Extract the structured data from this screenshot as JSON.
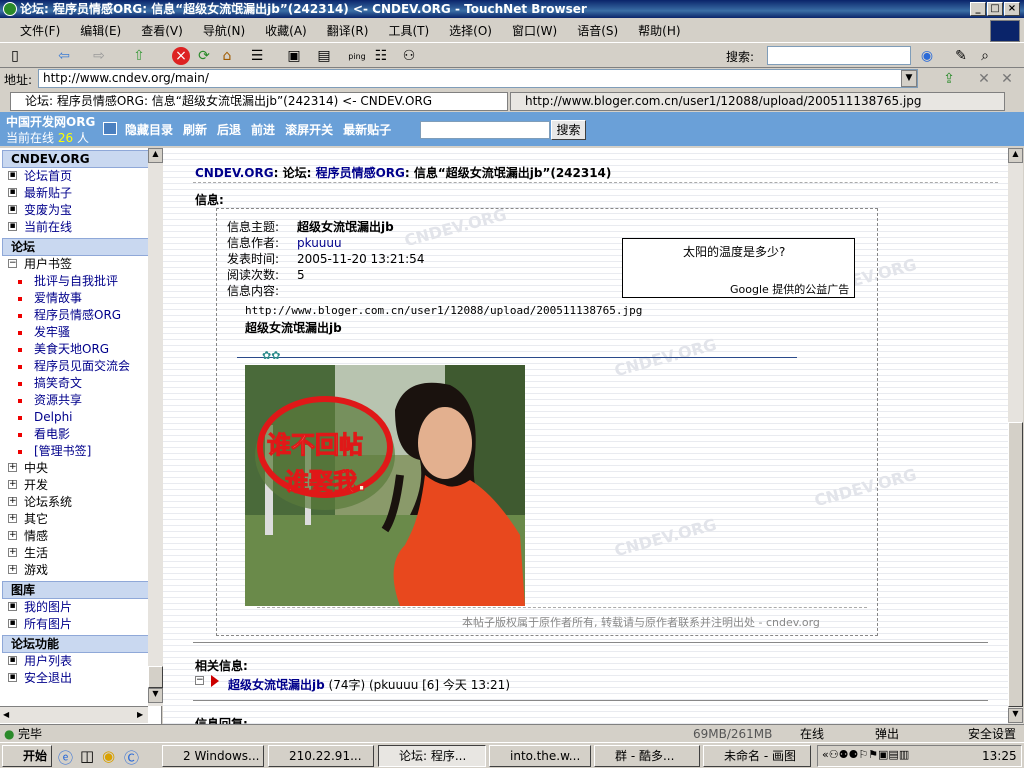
{
  "window": {
    "title": "论坛: 程序员情感ORG: 信息“超级女流氓漏出jb”(242314) <- CNDEV.ORG - TouchNet Browser"
  },
  "menu": [
    "文件(F)",
    "编辑(E)",
    "查看(V)",
    "导航(N)",
    "收藏(A)",
    "翻译(R)",
    "工具(T)",
    "选择(O)",
    "窗口(W)",
    "语音(S)",
    "帮助(H)"
  ],
  "toolbar": {
    "search_label": "搜索:"
  },
  "address": {
    "label": "地址:",
    "url": "http://www.cndev.org/main/"
  },
  "tabs": [
    {
      "label": "论坛: 程序员情感ORG: 信息“超级女流氓漏出jb”(242314) <- CNDEV.ORG"
    },
    {
      "label": "http://www.bloger.com.cn/user1/12088/upload/200511138765.jpg"
    }
  ],
  "site": {
    "name": "中国开发网ORG",
    "online_prefix": "当前在线",
    "online_count": "26",
    "online_suffix": "人",
    "nav": [
      "隐藏目录",
      "刷新",
      "后退",
      "前进",
      "滚屏开关",
      "最新贴子"
    ],
    "search_button": "搜索"
  },
  "sidebar": {
    "header1": "CNDEV.ORG",
    "items1": [
      "论坛首页",
      "最新贴子",
      "变废为宝",
      "当前在线"
    ],
    "header2": "论坛",
    "bookmarks": "用户书签",
    "sub": [
      "批评与自我批评",
      "爱情故事",
      "程序员情感ORG",
      "发牢骚",
      "美食天地ORG",
      "程序员见面交流会",
      "搞笑奇文",
      "资源共享",
      "Delphi",
      "看电影",
      "[管理书签]"
    ],
    "groups": [
      "中央",
      "开发",
      "论坛系统",
      "其它",
      "情感",
      "生活",
      "游戏"
    ],
    "header3": "图库",
    "gallery": [
      "我的图片",
      "所有图片"
    ],
    "header4": "论坛功能",
    "functions": [
      "用户列表",
      "安全退出"
    ]
  },
  "post": {
    "crumb_site": "CNDEV.ORG",
    "crumb_sep": ": 论坛:",
    "crumb_forum": "程序员情感ORG",
    "crumb_tail": ": 信息“超级女流氓漏出jb”(242314)",
    "info_label": "信息:",
    "fields": [
      {
        "label": "信息主题:",
        "value": "超级女流氓漏出jb"
      },
      {
        "label": "信息作者:",
        "value": "pkuuuu"
      },
      {
        "label": "发表时间:",
        "value": "2005-11-20 13:21:54"
      },
      {
        "label": "阅读次数:",
        "value": "5"
      },
      {
        "label": "信息内容:",
        "value": ""
      }
    ],
    "content_url": "http://www.bloger.com.cn/user1/12088/upload/200511138765.jpg",
    "content_title": "超级女流氓漏出jb",
    "image_text": "谁不回帖 谁娶我.",
    "copyright": "本帖子版权属于原作者所有, 转载请与原作者联系并注明出处 - cndev.org"
  },
  "ad": {
    "question": "太阳的温度是多少?",
    "google": "Google",
    "footer": "提供的公益广告"
  },
  "related": {
    "title": "相关信息:",
    "item_title": "超级女流氓漏出jb",
    "item_meta": "(74字) (pkuuuu [6] 今天 13:21)",
    "next": "信息回复:"
  },
  "watermark": "CNDEV.ORG",
  "statusbar": {
    "text": "完毕",
    "memory": "69MB/261MB",
    "online": "在线",
    "popup": "弹出",
    "security": "安全设置"
  },
  "taskbar": {
    "start": "开始",
    "tasks": [
      "2 Windows...",
      "210.22.91...",
      "论坛: 程序...",
      "into.the.w...",
      "群 - 酷多...",
      "未命名 - 画图"
    ],
    "clock": "13:25"
  },
  "colors": {
    "titlebar": "#0a246a",
    "bluebar": "#6aa0d8",
    "link": "#00008b",
    "shirt": "#e8481e"
  }
}
